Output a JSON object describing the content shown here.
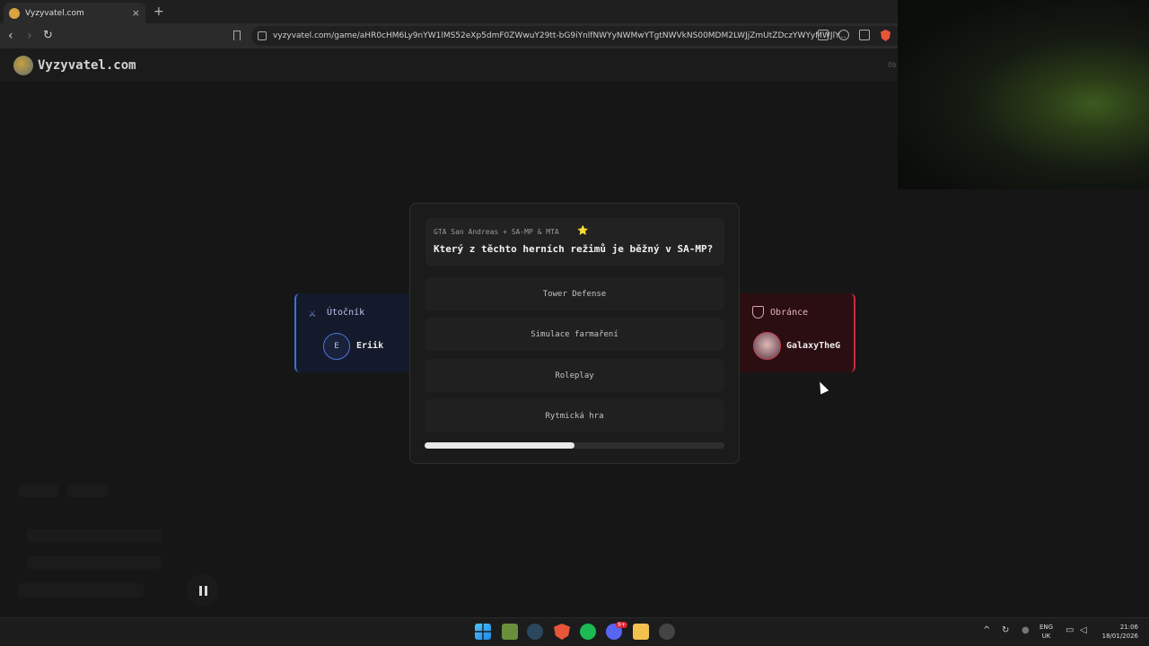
{
  "browser": {
    "tab_title": "Vyzyvatel.com",
    "tab_close": "×",
    "new_tab": "+",
    "url": "vyzyvatel.com/game/aHR0cHM6Ly9nYW1lMS52eXp5dmF0ZWwuY29tt-bG9iYnlfNWYyNWMwYTgtNWVkNS00MDM2LWJjZmUtZDczYWYyMWJlY..."
  },
  "site": {
    "logo_text": "Vyzyvatel.com",
    "header_right": "Ob"
  },
  "attacker": {
    "role": "Útočník",
    "avatar_letter": "E",
    "name": "Eriik",
    "color": "#3d6fe0",
    "icon": "sword-icon"
  },
  "defender": {
    "role": "Obránce",
    "name": "GalaxyTheG",
    "color": "#c72c3c",
    "icon": "shield-icon"
  },
  "quiz": {
    "category": "GTA San Andreas + SA-MP & MTA",
    "category_icon": "⭐",
    "question": "Který z těchto herních režimů je běžný v SA-MP?",
    "answers": [
      "Tower Defense",
      "Simulace farmaření",
      "Roleplay",
      "Rytmická hra"
    ],
    "timer_progress": 0.5
  },
  "taskbar": {
    "lang_line1": "ENG",
    "lang_line2": "UK",
    "time": "21:06",
    "date": "18/01/2026",
    "discord_badge": "9+"
  }
}
